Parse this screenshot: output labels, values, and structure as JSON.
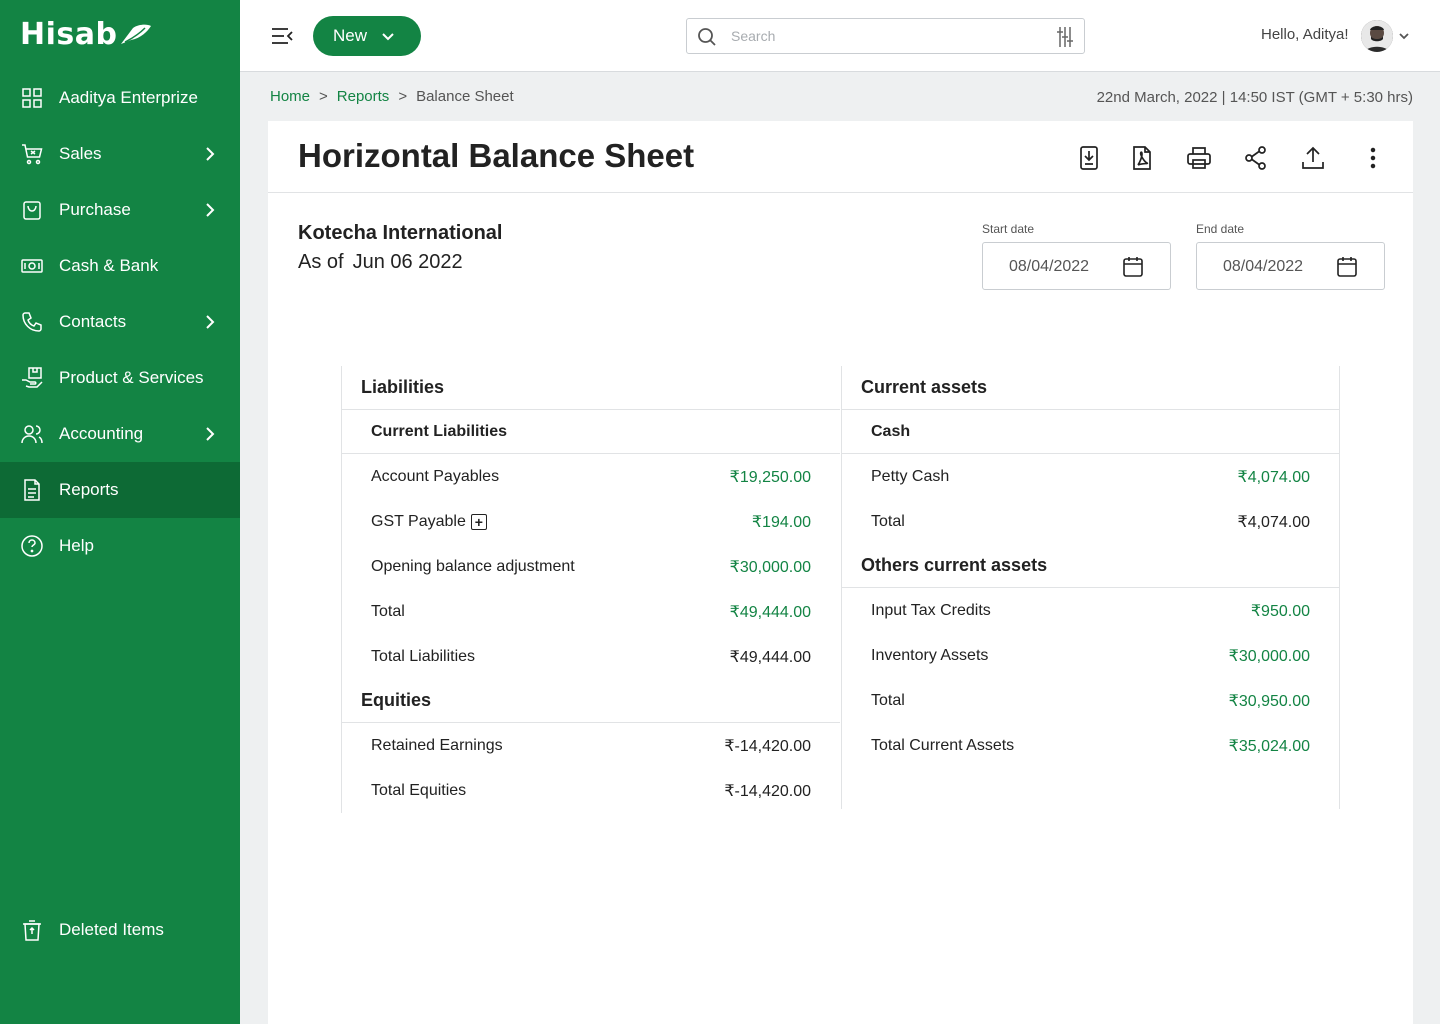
{
  "app": {
    "name": "Hisab"
  },
  "sidebar": {
    "items": [
      {
        "label": "Aaditya Enterprize",
        "icon": "grid-icon",
        "has_submenu": false
      },
      {
        "label": "Sales",
        "icon": "cart-icon",
        "has_submenu": true
      },
      {
        "label": "Purchase",
        "icon": "bag-icon",
        "has_submenu": true
      },
      {
        "label": "Cash & Bank",
        "icon": "cash-icon",
        "has_submenu": false
      },
      {
        "label": "Contacts",
        "icon": "phone-icon",
        "has_submenu": true
      },
      {
        "label": "Product & Services",
        "icon": "box-hand-icon",
        "has_submenu": false
      },
      {
        "label": "Accounting",
        "icon": "users-icon",
        "has_submenu": true
      },
      {
        "label": "Reports",
        "icon": "document-icon",
        "has_submenu": false,
        "active": true
      },
      {
        "label": "Help",
        "icon": "help-icon",
        "has_submenu": false
      }
    ],
    "deleted_label": "Deleted Items"
  },
  "topbar": {
    "new_label": "New",
    "search_placeholder": "Search",
    "greeting": "Hello, Aditya!"
  },
  "breadcrumb": {
    "home": "Home",
    "reports": "Reports",
    "current": "Balance Sheet",
    "separator": ">"
  },
  "timestamp": "22nd March, 2022 | 14:50 IST (GMT + 5:30 hrs)",
  "page": {
    "title": "Horizontal Balance Sheet",
    "company": "Kotecha International",
    "as_of_label": "As of",
    "as_of_date": "Jun 06 2022",
    "start_date_label": "Start date",
    "start_date": "08/04/2022",
    "end_date_label": "End date",
    "end_date": "08/04/2022"
  },
  "colors": {
    "brand": "#138444",
    "brand_dark": "#0d6a35"
  },
  "liabilities": {
    "heading": "Liabilities",
    "current_heading": "Current Liabilities",
    "rows": [
      {
        "label": "Account Payables",
        "amount": "₹19,250.00",
        "green": true
      },
      {
        "label": "GST Payable",
        "amount": "₹194.00",
        "green": true,
        "expand": true
      },
      {
        "label": "Opening balance adjustment",
        "amount": "₹30,000.00",
        "green": true
      },
      {
        "label": "Total",
        "amount": "₹49,444.00",
        "green": true
      },
      {
        "label": "Total Liabilities",
        "amount": "₹49,444.00",
        "green": false
      }
    ],
    "expand_symbol": "+"
  },
  "equities": {
    "heading": "Equities",
    "rows": [
      {
        "label": "Retained Earnings",
        "amount": "₹-14,420.00",
        "green": false
      },
      {
        "label": "Total Equities",
        "amount": "₹-14,420.00",
        "green": false
      }
    ]
  },
  "assets": {
    "heading": "Current assets",
    "cash_heading": "Cash",
    "cash_rows": [
      {
        "label": "Petty Cash",
        "amount": "₹4,074.00",
        "green": true
      },
      {
        "label": "Total",
        "amount": "₹4,074.00",
        "green": false
      }
    ],
    "others_heading": "Others current assets",
    "others_rows": [
      {
        "label": "Input Tax Credits",
        "amount": "₹950.00",
        "green": true
      },
      {
        "label": "Inventory Assets",
        "amount": "₹30,000.00",
        "green": true
      },
      {
        "label": "Total",
        "amount": "₹30,950.00",
        "green": true
      },
      {
        "label": "Total Current Assets",
        "amount": "₹35,024.00",
        "green": true
      }
    ]
  }
}
